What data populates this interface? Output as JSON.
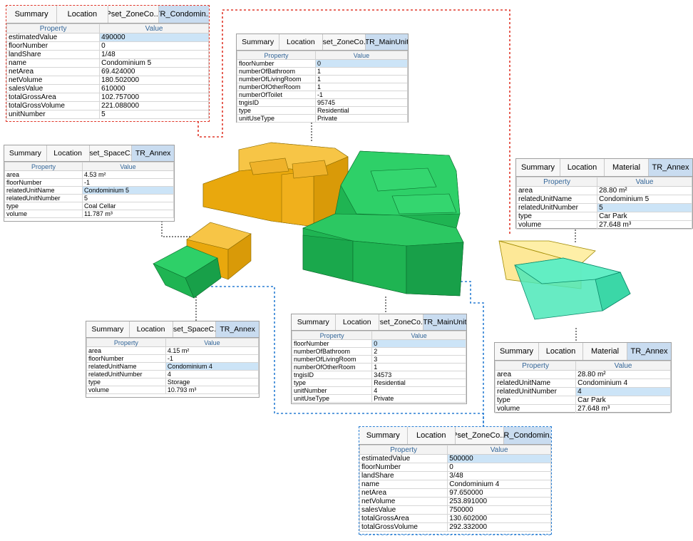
{
  "colors": {
    "annex_yellow": "#f3b31a",
    "main_green": "#22c35a",
    "dashed_red": "#e0382b",
    "dashed_blue": "#2a7fd4",
    "active_tab": "#c9dcf0",
    "highlight_row": "#cce4f7",
    "header_text": "#336699"
  },
  "panels": [
    {
      "id": "condo5",
      "tabs": [
        "Summary",
        "Location",
        "Pset_ZoneCo...",
        "TR_Condomin..."
      ],
      "active": 3,
      "headers": [
        "Property",
        "Value"
      ],
      "rows": [
        [
          "estimatedValue",
          "490000"
        ],
        [
          "floorNumber",
          "0"
        ],
        [
          "landShare",
          "1/48"
        ],
        [
          "name",
          "Condominium 5"
        ],
        [
          "netArea",
          "69.424000"
        ],
        [
          "netVolume",
          "180.502000"
        ],
        [
          "salesValue",
          "610000"
        ],
        [
          "totalGrossArea",
          "102.757000"
        ],
        [
          "totalGrossVolume",
          "221.088000"
        ],
        [
          "unitNumber",
          "5"
        ]
      ],
      "highlight": [
        0
      ]
    },
    {
      "id": "main5",
      "tabs": [
        "Summary",
        "Location",
        "Pset_ZoneCo...",
        "TR_MainUnit"
      ],
      "active": 3,
      "headers": [
        "Property",
        "Value"
      ],
      "rows": [
        [
          "floorNumber",
          "0"
        ],
        [
          "numberOfBathroom",
          "1"
        ],
        [
          "numberOfLivingRoom",
          "1"
        ],
        [
          "numberOfOtherRoom",
          "1"
        ],
        [
          "numberOfToilet",
          "-1"
        ],
        [
          "tngisID",
          "95745"
        ],
        [
          "type",
          "Residential"
        ],
        [
          "unitUseType",
          "Private"
        ]
      ],
      "highlight": [
        0
      ]
    },
    {
      "id": "annex5cellar",
      "tabs": [
        "Summary",
        "Location",
        "Pset_SpaceC...",
        "TR_Annex"
      ],
      "active": 3,
      "headers": [
        "Property",
        "Value"
      ],
      "rows": [
        [
          "area",
          "4.53 m²"
        ],
        [
          "floorNumber",
          "-1"
        ],
        [
          "relatedUnitName",
          "Condominium 5"
        ],
        [
          "relatedUnitNumber",
          "5"
        ],
        [
          "type",
          "Coal Cellar"
        ],
        [
          "volume",
          "11.787 m³"
        ]
      ],
      "highlight": [
        2
      ]
    },
    {
      "id": "annex5park",
      "tabs": [
        "Summary",
        "Location",
        "Material",
        "TR_Annex"
      ],
      "active": 3,
      "headers": [
        "Property",
        "Value"
      ],
      "rows": [
        [
          "area",
          "28.80 m²"
        ],
        [
          "relatedUnitName",
          "Condominium 5"
        ],
        [
          "relatedUnitNumber",
          "5"
        ],
        [
          "type",
          "Car Park"
        ],
        [
          "volume",
          "27.648 m³"
        ]
      ],
      "highlight": [
        2
      ]
    },
    {
      "id": "annex4storage",
      "tabs": [
        "Summary",
        "Location",
        "Pset_SpaceC...",
        "TR_Annex"
      ],
      "active": 3,
      "headers": [
        "Property",
        "Value"
      ],
      "rows": [
        [
          "area",
          "4.15 m²"
        ],
        [
          "floorNumber",
          "-1"
        ],
        [
          "relatedUnitName",
          "Condominium 4"
        ],
        [
          "relatedUnitNumber",
          "4"
        ],
        [
          "type",
          "Storage"
        ],
        [
          "volume",
          "10.793 m³"
        ]
      ],
      "highlight": [
        2
      ]
    },
    {
      "id": "main4",
      "tabs": [
        "Summary",
        "Location",
        "Pset_ZoneCo...",
        "TR_MainUnit"
      ],
      "active": 3,
      "headers": [
        "Property",
        "Value"
      ],
      "rows": [
        [
          "floorNumber",
          "0"
        ],
        [
          "numberOfBathroom",
          "2"
        ],
        [
          "numberOfLivingRoom",
          "3"
        ],
        [
          "numberOfOtherRoom",
          "1"
        ],
        [
          "tngisID",
          "34573"
        ],
        [
          "type",
          "Residential"
        ],
        [
          "unitNumber",
          "4"
        ],
        [
          "unitUseType",
          "Private"
        ]
      ],
      "highlight": [
        0
      ]
    },
    {
      "id": "annex4park",
      "tabs": [
        "Summary",
        "Location",
        "Material",
        "TR_Annex"
      ],
      "active": 3,
      "headers": [
        "Property",
        "Value"
      ],
      "rows": [
        [
          "area",
          "28.80 m²"
        ],
        [
          "relatedUnitName",
          "Condominium 4"
        ],
        [
          "relatedUnitNumber",
          "4"
        ],
        [
          "type",
          "Car Park"
        ],
        [
          "volume",
          "27.648 m³"
        ]
      ],
      "highlight": [
        2
      ]
    },
    {
      "id": "condo4",
      "tabs": [
        "Summary",
        "Location",
        "Pset_ZoneCo...",
        "TR_Condomin..."
      ],
      "active": 3,
      "headers": [
        "Property",
        "Value"
      ],
      "rows": [
        [
          "estimatedValue",
          "500000"
        ],
        [
          "floorNumber",
          "0"
        ],
        [
          "landShare",
          "3/48"
        ],
        [
          "name",
          "Condominium 4"
        ],
        [
          "netArea",
          "97.650000"
        ],
        [
          "netVolume",
          "253.891000"
        ],
        [
          "salesValue",
          "750000"
        ],
        [
          "totalGrossArea",
          "130.602000"
        ],
        [
          "totalGrossVolume",
          "292.332000"
        ]
      ],
      "highlight": [
        0
      ]
    }
  ]
}
